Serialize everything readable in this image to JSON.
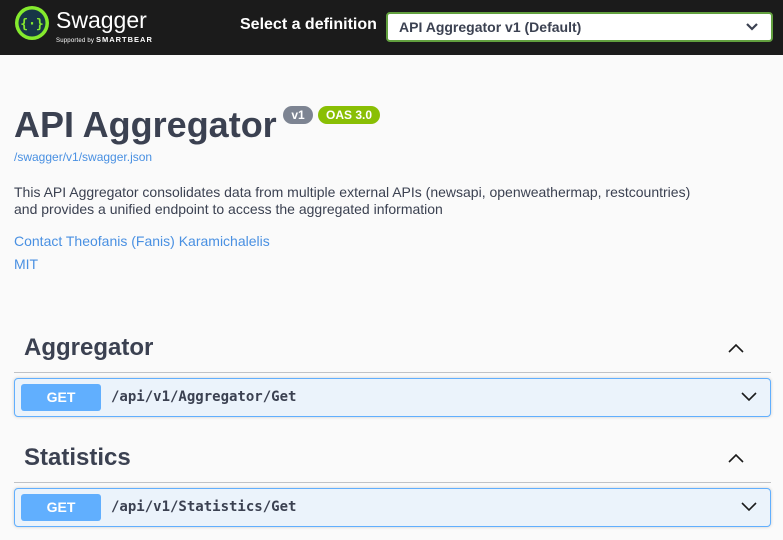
{
  "topbar": {
    "logo": {
      "name": "Swagger",
      "tagline_prefix": "Supported by",
      "tagline_brand": "SMARTBEAR"
    },
    "definition_label": "Select a definition",
    "definition_selected": "API Aggregator v1 (Default)"
  },
  "info": {
    "title": "API Aggregator",
    "version_badge": "v1",
    "oas_badge": "OAS 3.0",
    "spec_url": "/swagger/v1/swagger.json",
    "description_lines": [
      "This API Aggregator consolidates data from multiple external APIs (newsapi, openweathermap, restcountries)",
      "and provides a unified endpoint to access the aggregated information"
    ],
    "contact": "Contact Theofanis (Fanis) Karamichalelis",
    "license": "MIT"
  },
  "tags": [
    {
      "name": "Aggregator",
      "operations": [
        {
          "method": "GET",
          "path": "/api/v1/Aggregator/Get"
        }
      ]
    },
    {
      "name": "Statistics",
      "operations": [
        {
          "method": "GET",
          "path": "/api/v1/Statistics/Get"
        }
      ]
    }
  ],
  "colors": {
    "topbar_bg": "#1b1b1b",
    "brand_green": "#85ea2d",
    "select_border": "#62a03f",
    "get_blue": "#61affe",
    "get_bg": "#ebf3fb",
    "link_blue": "#4990e2",
    "oas_green": "#89bf04",
    "version_gray": "#7d8492"
  },
  "icons": {
    "logo": "swagger-logo-icon",
    "select_chevron": "chevron-down-icon",
    "section_toggle": "chevron-up-icon",
    "operation_toggle": "chevron-down-icon"
  }
}
